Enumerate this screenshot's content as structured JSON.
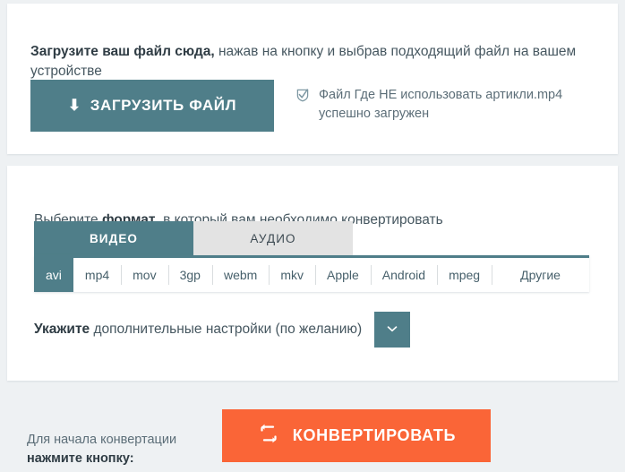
{
  "theme": {
    "teal": "#4f7e89",
    "orange": "#fa6537",
    "page_bg": "#eef1f3",
    "card_bg": "#ffffff",
    "tab_inactive_bg": "#e3e3e3",
    "text": "#465760"
  },
  "upload": {
    "lead_bold": "Загрузите ваш файл сюда,",
    "lead_rest": " нажав на кнопку и выбрав подходящий файл на вашем устройстве",
    "button_label": "ЗАГРУЗИТЬ ФАЙЛ",
    "button_icon": "download-arrow-icon",
    "status_icon": "check-shield-icon",
    "status_text": "Файл Где НЕ использовать артикли.mp4 успешно загружен"
  },
  "format": {
    "lead_start": "Выберите ",
    "lead_bold": "формат",
    "lead_end": ", в который вам необходимо конвертировать",
    "tabs": [
      {
        "label": "ВИДЕО",
        "active": true
      },
      {
        "label": "АУДИО",
        "active": false
      }
    ],
    "items": [
      {
        "label": "avi",
        "selected": true
      },
      {
        "label": "mp4",
        "selected": false
      },
      {
        "label": "mov",
        "selected": false
      },
      {
        "label": "3gp",
        "selected": false
      },
      {
        "label": "webm",
        "selected": false
      },
      {
        "label": "mkv",
        "selected": false
      },
      {
        "label": "Apple",
        "selected": false
      },
      {
        "label": "Android",
        "selected": false
      },
      {
        "label": "mpeg",
        "selected": false
      },
      {
        "label": "Другие",
        "selected": false
      }
    ]
  },
  "settings": {
    "lead_bold": "Укажите",
    "lead_rest": " дополнительные настройки (по желанию)",
    "toggle_icon": "chevron-down-icon"
  },
  "convert": {
    "hint_line1": "Для начала конвертации",
    "hint_line2": "нажмите кнопку:",
    "button_label": "КОНВЕРТИРОВАТЬ",
    "button_icon": "loop-refresh-icon"
  }
}
